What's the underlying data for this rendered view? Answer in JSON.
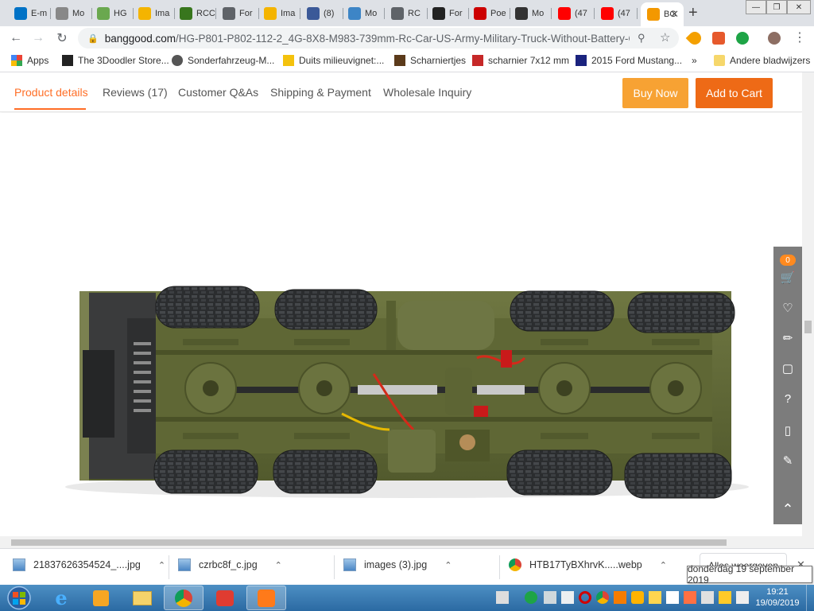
{
  "browser": {
    "tabs": [
      {
        "label": "E-m",
        "icon": "outlook-icon",
        "color": "#0072c6"
      },
      {
        "label": "Mo",
        "icon": "page-icon",
        "color": "#888888"
      },
      {
        "label": "HG",
        "icon": "leaf-icon",
        "color": "#6aa84f"
      },
      {
        "label": "Ima",
        "icon": "image-search-icon",
        "color": "#f4b400"
      },
      {
        "label": "RCC",
        "icon": "rc-forum-icon",
        "color": "#38761d"
      },
      {
        "label": "For",
        "icon": "globe-icon",
        "color": "#5f6368"
      },
      {
        "label": "Ima",
        "icon": "image-search-icon",
        "color": "#f4b400"
      },
      {
        "label": "(8)",
        "icon": "facebook-icon",
        "color": "#3b5998"
      },
      {
        "label": "Mo",
        "icon": "page-icon",
        "color": "#3d85c6"
      },
      {
        "label": "RC",
        "icon": "globe-icon",
        "color": "#5f6368"
      },
      {
        "label": "For",
        "icon": "forum-icon",
        "color": "#222222"
      },
      {
        "label": "Poe",
        "icon": "poe-icon",
        "color": "#cc0000"
      },
      {
        "label": "Mo",
        "icon": "shop-icon",
        "color": "#333333"
      },
      {
        "label": "(47",
        "icon": "youtube-icon",
        "color": "#ff0000"
      },
      {
        "label": "(47",
        "icon": "youtube-icon",
        "color": "#ff0000"
      },
      {
        "label": "BG",
        "icon": "banggood-icon",
        "color": "#f39800",
        "active": true
      }
    ],
    "new_tab_label": "+",
    "url_host": "banggood.com",
    "url_path": "/HG-P801-P802-112-2_4G-8X8-M983-739mm-Rc-Car-US-Army-Military-Truck-Without-Battery-Cha..."
  },
  "bookmarks": [
    {
      "label": "Apps",
      "icon": "apps-grid-icon"
    },
    {
      "label": "The 3Doodler Store...",
      "icon": "pen-icon"
    },
    {
      "label": "Sonderfahrzeug-M...",
      "icon": "globe-icon"
    },
    {
      "label": "Duits milieuvignet:...",
      "icon": "vab-icon"
    },
    {
      "label": "Scharniertjes",
      "icon": "bookmark-photo-icon"
    },
    {
      "label": "scharnier 7x12 mm",
      "icon": "bookmark-red-icon"
    },
    {
      "label": "2015 Ford Mustang...",
      "icon": "bookmark-blue-icon"
    }
  ],
  "bookmarks_more": "»",
  "bookmarks_other": "Andere bladwijzers",
  "page_tabs": [
    {
      "label": "Product details",
      "active": true
    },
    {
      "label": "Reviews (17)"
    },
    {
      "label": "Customer Q&As"
    },
    {
      "label": "Shipping & Payment"
    },
    {
      "label": "Wholesale Inquiry"
    }
  ],
  "buy_now_label": "Buy Now",
  "add_to_cart_label": "Add to Cart",
  "cart_count": "0",
  "colors": {
    "accent": "#ff6e26",
    "buy_now": "#f7a233",
    "add_to_cart": "#ee6a16",
    "truck_olive": "#626a38"
  },
  "downloads": [
    {
      "name": "21837626354524_....jpg",
      "icon": "image-file-icon"
    },
    {
      "name": "czrbc8f_c.jpg",
      "icon": "image-file-icon"
    },
    {
      "name": "images (3).jpg",
      "icon": "image-file-icon"
    },
    {
      "name": "HTB17TyBXhrvK.....webp",
      "icon": "chrome-file-icon"
    }
  ],
  "show_all_label": "Alles weergeven",
  "tooltip": "donderdag 19 september 2019",
  "clock": {
    "time": "19:21",
    "date": "19/09/2019"
  }
}
